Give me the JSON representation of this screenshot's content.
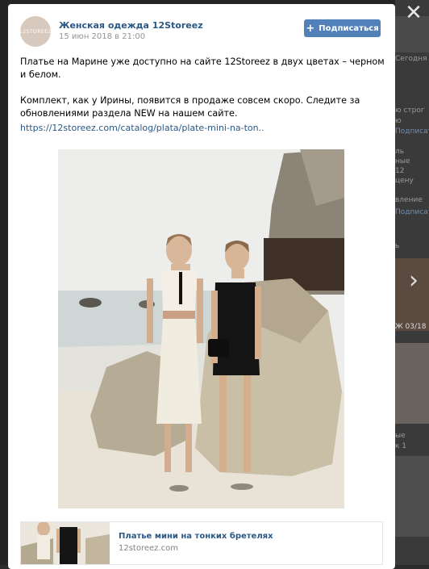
{
  "post": {
    "group_name": "Женская одежда 12Storeez",
    "date": "15 июн 2018 в 21:00",
    "avatar_text": "12STOREEZ",
    "subscribe_label": "Подписаться",
    "paragraph1": "Платье на Марине уже доступно на сайте 12Storeez в двух цветах – черном и белом.",
    "paragraph2": "Комплект, как у Ирины, появится в продаже совсем скоро. Следите за обновлениями раздела NEW на нашем сайте.",
    "link": "https://12storeez.com/catalog/plata/plate-mini-na-ton.."
  },
  "snippet": {
    "title": "Платье мини на тонких бретелях",
    "domain": "12storeez.com"
  },
  "background": {
    "texts": [
      "Сегодня",
      "ю строг",
      "ю",
      "Подписат",
      "ль",
      "ные",
      "12",
      "цену",
      "вление",
      "Подписат",
      "ь",
      "Ж 03/18",
      "ые",
      "к 1"
    ]
  },
  "controls": {
    "close_icon": "✕",
    "next_icon": "›"
  },
  "colors": {
    "link": "#2a5885",
    "button": "#5181b8",
    "overlay": "#242424"
  }
}
